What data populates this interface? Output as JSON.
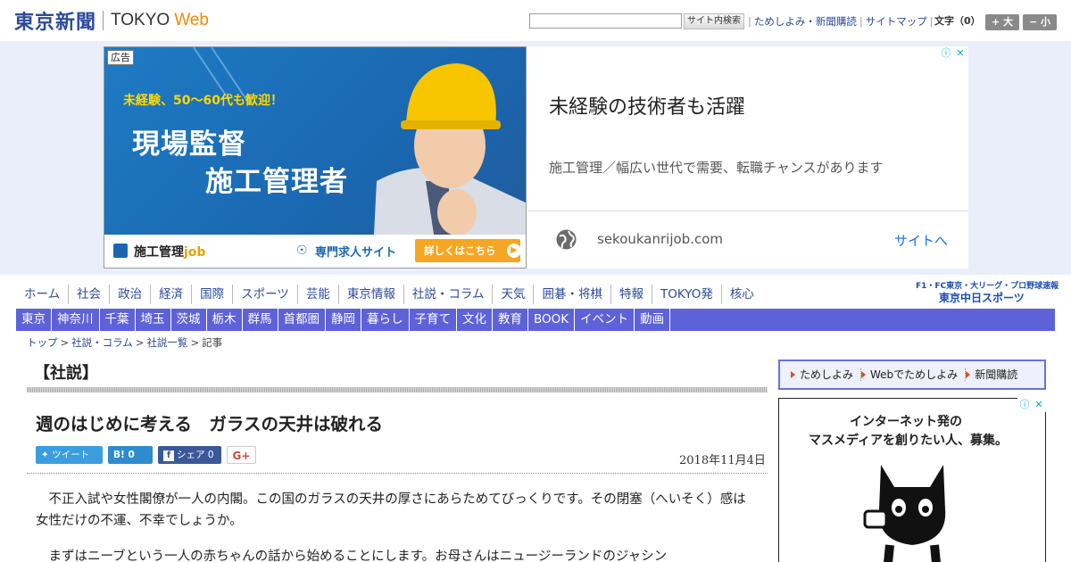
{
  "header": {
    "logo_main": "東京新聞",
    "logo_tokyo": "TOKYO",
    "logo_web": "Web",
    "search_placeholder": "",
    "search_button": "サイト内検索",
    "links": [
      "ためしよみ・新聞購読",
      "サイトマップ"
    ],
    "font_size_label": "文字（0）",
    "font_larger": "+ 大",
    "font_smaller": "− 小"
  },
  "ad": {
    "badge": "広告",
    "sub": "未経験、50〜60代も歓迎！",
    "headline1": "現場監督",
    "headline2": "施工管理者",
    "brand_prefix": "施工管理",
    "brand_job": "job",
    "site_label": "専門求人サイト",
    "cta": "詳しくはこちら",
    "title": "未経験の技術者も活躍",
    "description": "施工管理／幅広い世代で需要、転職チャンスがあります",
    "domain": "sekoukanrijob.com",
    "site_link": "サイトへ"
  },
  "nav_main": [
    "ホーム",
    "社会",
    "政治",
    "経済",
    "国際",
    "スポーツ",
    "芸能",
    "東京情報",
    "社説・コラム",
    "天気",
    "囲碁・将棋",
    "特報",
    "TOKYO発",
    "核心"
  ],
  "nav_sub_brand": {
    "line1": "F1・FC東京・大リーグ・プロ野球速報",
    "line2": "東京中日スポーツ"
  },
  "nav_regions": [
    "東京",
    "神奈川",
    "千葉",
    "埼玉",
    "茨城",
    "栃木",
    "群馬",
    "首都圏",
    "静岡",
    "暮らし",
    "子育て",
    "文化",
    "教育",
    "BOOK",
    "イベント",
    "動画"
  ],
  "breadcrumb": [
    "トップ",
    "社説・コラム",
    "社説一覧",
    "記事"
  ],
  "article": {
    "section": "【社説】",
    "title": "週のはじめに考える　ガラスの天井は破れる",
    "share": {
      "tweet": "ツイート",
      "hatena": "B! 0",
      "facebook": "シェア 0",
      "gplus": "G+"
    },
    "date": "2018年11月4日",
    "paragraphs": [
      "不正入試や女性閣僚が一人の内閣。この国のガラスの天井の厚さにあらためてびっくりです。その閉塞（へいそく）感は女性だけの不運、不幸でしょうか。",
      "まずはニーブという一人の赤ちゃんの話から始めることにします。お母さんはニュージーランドのジャシン"
    ]
  },
  "sidebar": {
    "promo_links": [
      "ためしよみ",
      "Webでためしよみ",
      "新聞購読"
    ],
    "ad_text1": "インターネット発の",
    "ad_text2": "マスメディアを創りたい人、募集。"
  }
}
